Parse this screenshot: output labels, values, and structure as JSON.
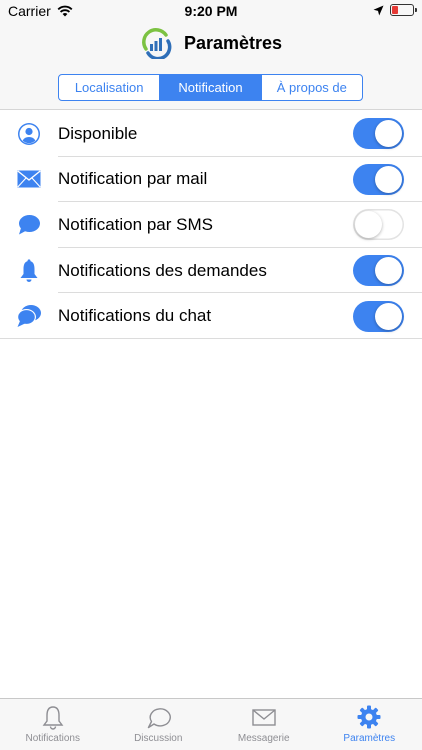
{
  "status_bar": {
    "carrier": "Carrier",
    "time": "9:20 PM"
  },
  "header": {
    "title": "Paramètres"
  },
  "tabs": [
    {
      "label": "Localisation",
      "active": false
    },
    {
      "label": "Notification",
      "active": true
    },
    {
      "label": "À propos de",
      "active": false
    }
  ],
  "settings": [
    {
      "label": "Disponible",
      "icon": "user-icon",
      "on": true
    },
    {
      "label": "Notification par mail",
      "icon": "mail-icon",
      "on": true
    },
    {
      "label": "Notification par SMS",
      "icon": "sms-icon",
      "on": false
    },
    {
      "label": "Notifications des demandes",
      "icon": "bell-icon",
      "on": true
    },
    {
      "label": "Notifications du chat",
      "icon": "chat-icon",
      "on": true
    }
  ],
  "tab_bar": [
    {
      "label": "Notifications",
      "icon": "bell-outline-icon",
      "active": false
    },
    {
      "label": "Discussion",
      "icon": "chat-bubble-outline-icon",
      "active": false
    },
    {
      "label": "Messagerie",
      "icon": "envelope-outline-icon",
      "active": false
    },
    {
      "label": "Paramètres",
      "icon": "gear-icon",
      "active": true
    }
  ],
  "colors": {
    "accent": "#3d83f0",
    "battery_low": "#e53935",
    "logo_green": "#7cc242",
    "logo_blue": "#2f6fb8"
  }
}
